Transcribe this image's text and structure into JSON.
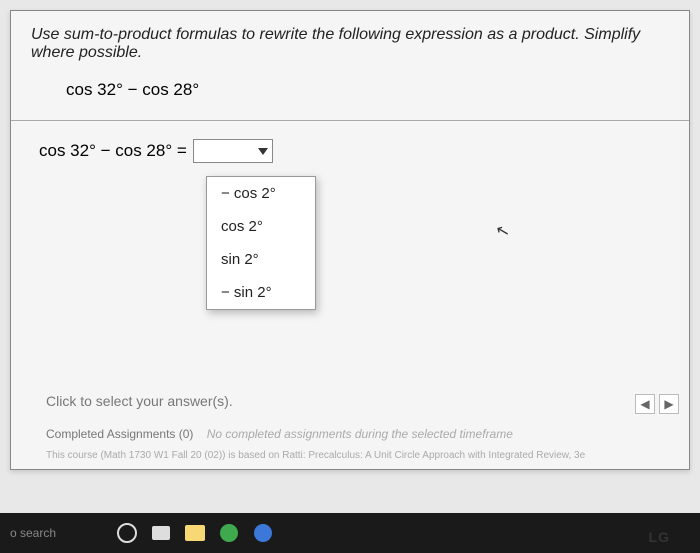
{
  "instruction": "Use sum-to-product formulas to rewrite the following expression as a product. Simplify where possible.",
  "expression": "cos 32° − cos 28°",
  "equation_lhs": "cos 32° − cos 28° =",
  "dropdown": {
    "options": [
      "− cos 2°",
      "cos 2°",
      "sin 2°",
      "− sin 2°"
    ]
  },
  "hint": "Click to select your answer(s).",
  "completed": {
    "label": "Completed Assignments (0)",
    "sub": "No completed assignments during the selected timeframe"
  },
  "course_line": "This course (Math 1730 W1 Fall 20 (02)) is based on Ratti: Precalculus: A Unit Circle Approach with Integrated Review, 3e",
  "nav": {
    "prev": "◀",
    "next": "▶"
  },
  "taskbar": {
    "search": "o search"
  },
  "brand": "LG"
}
